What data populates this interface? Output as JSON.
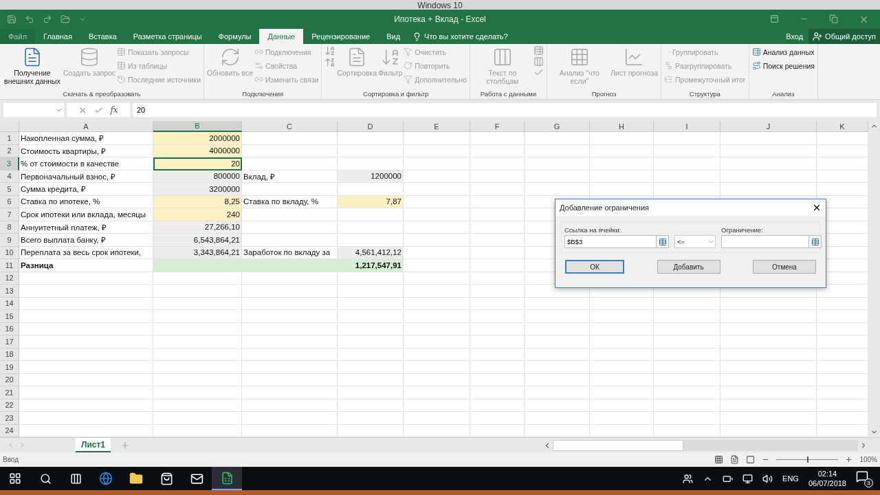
{
  "mac_bar": {
    "caption": "Windows 10"
  },
  "title_bar": {
    "title": "Ипотека + Вклад - Excel"
  },
  "tabs": [
    {
      "label": "Файл",
      "selected": false,
      "kind": "file"
    },
    {
      "label": "Главная",
      "selected": false,
      "kind": "tab"
    },
    {
      "label": "Вставка",
      "selected": false,
      "kind": "tab"
    },
    {
      "label": "Разметка страницы",
      "selected": false,
      "kind": "tab"
    },
    {
      "label": "Формулы",
      "selected": false,
      "kind": "tab"
    },
    {
      "label": "Данные",
      "selected": true,
      "kind": "tab"
    },
    {
      "label": "Рецензирование",
      "selected": false,
      "kind": "tab"
    },
    {
      "label": "Вид",
      "selected": false,
      "kind": "tab"
    }
  ],
  "tell_me": "Что вы хотите сделать?",
  "sign_in": "Вход",
  "share": "Общий доступ",
  "ribbon": {
    "groups": [
      {
        "label": "Скачать & преобразовать",
        "items": [
          {
            "kind": "large",
            "label": "Получение внешних данных",
            "disabled": false
          },
          {
            "kind": "large",
            "label": "Создать запрос",
            "disabled": true
          },
          {
            "kind": "small",
            "label": "Показать запросы",
            "disabled": true
          },
          {
            "kind": "small",
            "label": "Из таблицы",
            "disabled": true
          },
          {
            "kind": "small",
            "label": "Последние источники",
            "disabled": true
          }
        ]
      },
      {
        "label": "Подключения",
        "items": [
          {
            "kind": "large",
            "label": "Обновить все",
            "disabled": true
          },
          {
            "kind": "small",
            "label": "Подключения",
            "disabled": true
          },
          {
            "kind": "small",
            "label": "Свойства",
            "disabled": true
          },
          {
            "kind": "small",
            "label": "Изменить связи",
            "disabled": true
          }
        ]
      },
      {
        "label": "Сортировка и фильтр",
        "items": [
          {
            "kind": "sort",
            "disabled": true
          },
          {
            "kind": "large",
            "label": "Сортировка",
            "disabled": true
          },
          {
            "kind": "large",
            "label": "Фильтр",
            "disabled": true
          },
          {
            "kind": "small",
            "label": "Очистить",
            "disabled": true
          },
          {
            "kind": "small",
            "label": "Повторить",
            "disabled": true
          },
          {
            "kind": "small",
            "label": "Дополнительно",
            "disabled": true
          }
        ]
      },
      {
        "label": "Работа с данными",
        "items": [
          {
            "kind": "large",
            "label": "Текст по столбцам",
            "disabled": true
          },
          {
            "kind": "tools",
            "disabled": true
          }
        ]
      },
      {
        "label": "Прогноз",
        "items": [
          {
            "kind": "large",
            "label": "Анализ \"что если\"",
            "disabled": true
          },
          {
            "kind": "large",
            "label": "Лист прогноза",
            "disabled": true
          }
        ]
      },
      {
        "label": "Структура",
        "items": [
          {
            "kind": "small",
            "label": "Группировать",
            "disabled": true
          },
          {
            "kind": "small",
            "label": "Разгруппировать",
            "disabled": true
          },
          {
            "kind": "small",
            "label": "Промежуточный итог",
            "disabled": true
          }
        ]
      },
      {
        "label": "Анализ",
        "items": [
          {
            "kind": "small",
            "label": "Анализ данных",
            "disabled": false
          },
          {
            "kind": "small",
            "label": "Поиск решения",
            "disabled": false
          }
        ]
      }
    ]
  },
  "formula_bar": {
    "function_button": "fx",
    "value": "20"
  },
  "columns": [
    {
      "label": "A",
      "selected": false
    },
    {
      "label": "B",
      "selected": true
    },
    {
      "label": "C",
      "selected": false
    },
    {
      "label": "D",
      "selected": false
    },
    {
      "label": "E",
      "selected": false
    },
    {
      "label": "F",
      "selected": false
    },
    {
      "label": "G",
      "selected": false
    },
    {
      "label": "H",
      "selected": false
    },
    {
      "label": "I",
      "selected": false
    },
    {
      "label": "J",
      "selected": false
    },
    {
      "label": "K",
      "selected": false
    }
  ],
  "rows": [
    {
      "number": "1",
      "selected": false,
      "cells": [
        {
          "text": "Накопленная сумма, ₽",
          "kind": "plain"
        },
        {
          "text": "2000000",
          "kind": "input"
        }
      ]
    },
    {
      "number": "2",
      "selected": false,
      "cells": [
        {
          "text": "Стоимость квартиры, ₽",
          "kind": "plain"
        },
        {
          "text": "4000000",
          "kind": "input"
        }
      ]
    },
    {
      "number": "3",
      "selected": true,
      "cells": [
        {
          "text": "% от стоимости в качестве",
          "kind": "plain"
        },
        {
          "text": "20",
          "kind": "input",
          "active": true
        }
      ]
    },
    {
      "number": "4",
      "selected": false,
      "cells": [
        {
          "text": "Первоначальный взнос, ₽",
          "kind": "plain"
        },
        {
          "text": "800000",
          "kind": "calc"
        },
        {
          "text": "Вклад, ₽",
          "kind": "plain"
        },
        {
          "text": "1200000",
          "kind": "calc"
        }
      ]
    },
    {
      "number": "5",
      "selected": false,
      "cells": [
        {
          "text": "Сумма кредита, ₽",
          "kind": "plain"
        },
        {
          "text": "3200000",
          "kind": "calc"
        }
      ]
    },
    {
      "number": "6",
      "selected": false,
      "cells": [
        {
          "text": "Ставка по ипотеке, %",
          "kind": "plain"
        },
        {
          "text": "8,25",
          "kind": "input"
        },
        {
          "text": "Ставка по вкладу, %",
          "kind": "plain"
        },
        {
          "text": "7,87",
          "kind": "input"
        }
      ]
    },
    {
      "number": "7",
      "selected": false,
      "cells": [
        {
          "text": "Срок ипотеки или вклада, месяцы",
          "kind": "plain"
        },
        {
          "text": "240",
          "kind": "input"
        }
      ]
    },
    {
      "number": "8",
      "selected": false,
      "cells": [
        {
          "text": "Аннуитетный платеж, ₽",
          "kind": "plain"
        },
        {
          "text": "27,266,10",
          "kind": "calc"
        }
      ]
    },
    {
      "number": "9",
      "selected": false,
      "cells": [
        {
          "text": "Всего выплата банку, ₽",
          "kind": "plain"
        },
        {
          "text": "6,543,864,21",
          "kind": "calc"
        }
      ]
    },
    {
      "number": "10",
      "selected": false,
      "cells": [
        {
          "text": "Переплата за весь срок ипотеки,",
          "kind": "plain"
        },
        {
          "text": "3,343,864,21",
          "kind": "calc"
        },
        {
          "text": "Заработок по вкладу за",
          "kind": "plain"
        },
        {
          "text": "4,561,412,12",
          "kind": "calc"
        }
      ]
    },
    {
      "number": "11",
      "selected": false,
      "cells": [
        {
          "text": "Разница",
          "kind": "plain",
          "bold": true
        },
        {
          "kind": "total"
        },
        {
          "kind": "total"
        },
        {
          "text": "1,217,547,91",
          "kind": "total",
          "bold": true
        }
      ]
    },
    {
      "number": "12",
      "selected": false,
      "cells": []
    },
    {
      "number": "13",
      "selected": false,
      "cells": []
    },
    {
      "number": "14",
      "selected": false,
      "cells": []
    },
    {
      "number": "15",
      "selected": false,
      "cells": []
    },
    {
      "number": "16",
      "selected": false,
      "cells": []
    },
    {
      "number": "17",
      "selected": false,
      "cells": []
    },
    {
      "number": "18",
      "selected": false,
      "cells": []
    },
    {
      "number": "19",
      "selected": false,
      "cells": []
    },
    {
      "number": "20",
      "selected": false,
      "cells": []
    },
    {
      "number": "21",
      "selected": false,
      "cells": []
    },
    {
      "number": "22",
      "selected": false,
      "cells": []
    },
    {
      "number": "23",
      "selected": false,
      "cells": []
    },
    {
      "number": "24",
      "selected": false,
      "cells": []
    }
  ],
  "dialog": {
    "title": "Добавление ограничения",
    "cell_ref": {
      "label": "Ссылка на ячейки:",
      "value": "$B$3"
    },
    "operator": {
      "value": "<="
    },
    "constraint": {
      "label": "Ограничение:"
    },
    "buttons": [
      {
        "label": "ОК",
        "default": true
      },
      {
        "label": "Добавить",
        "default": false
      },
      {
        "label": "Отмена",
        "default": false
      }
    ]
  },
  "sheet_tabs": [
    {
      "label": "Лист1",
      "selected": true
    }
  ],
  "status_bar": {
    "mode": "Ввод",
    "zoom": "100%",
    "zoom_slider": {
      "level": 0.5
    }
  },
  "taskbar": {
    "language": "ENG",
    "time": "02:14",
    "date": "06/07/2018",
    "notifications": "3"
  }
}
